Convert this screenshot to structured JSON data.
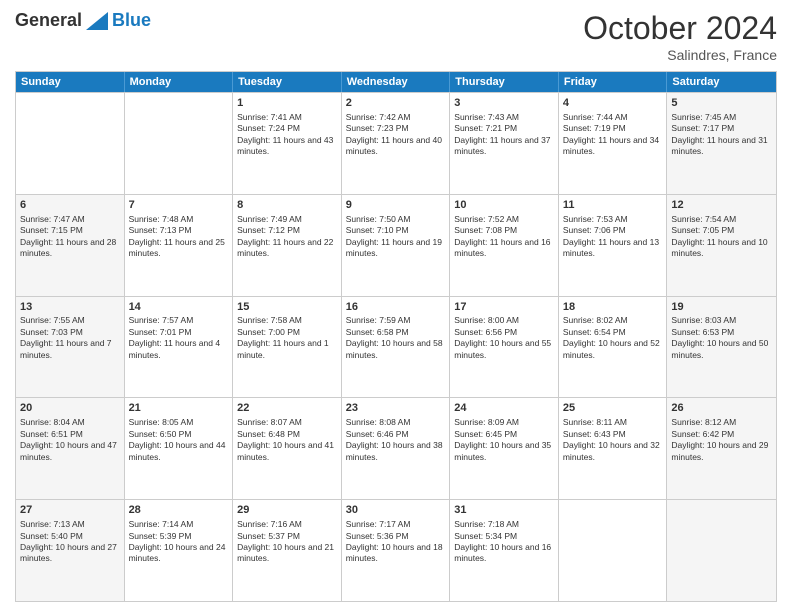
{
  "header": {
    "logo_general": "General",
    "logo_blue": "Blue",
    "month": "October 2024",
    "location": "Salindres, France"
  },
  "days_of_week": [
    "Sunday",
    "Monday",
    "Tuesday",
    "Wednesday",
    "Thursday",
    "Friday",
    "Saturday"
  ],
  "rows": [
    [
      {
        "day": "",
        "empty": true,
        "shaded": false
      },
      {
        "day": "",
        "empty": true,
        "shaded": false
      },
      {
        "day": "1",
        "sunrise": "Sunrise: 7:41 AM",
        "sunset": "Sunset: 7:24 PM",
        "daylight": "Daylight: 11 hours and 43 minutes.",
        "shaded": false
      },
      {
        "day": "2",
        "sunrise": "Sunrise: 7:42 AM",
        "sunset": "Sunset: 7:23 PM",
        "daylight": "Daylight: 11 hours and 40 minutes.",
        "shaded": false
      },
      {
        "day": "3",
        "sunrise": "Sunrise: 7:43 AM",
        "sunset": "Sunset: 7:21 PM",
        "daylight": "Daylight: 11 hours and 37 minutes.",
        "shaded": false
      },
      {
        "day": "4",
        "sunrise": "Sunrise: 7:44 AM",
        "sunset": "Sunset: 7:19 PM",
        "daylight": "Daylight: 11 hours and 34 minutes.",
        "shaded": false
      },
      {
        "day": "5",
        "sunrise": "Sunrise: 7:45 AM",
        "sunset": "Sunset: 7:17 PM",
        "daylight": "Daylight: 11 hours and 31 minutes.",
        "shaded": true
      }
    ],
    [
      {
        "day": "6",
        "sunrise": "Sunrise: 7:47 AM",
        "sunset": "Sunset: 7:15 PM",
        "daylight": "Daylight: 11 hours and 28 minutes.",
        "shaded": true
      },
      {
        "day": "7",
        "sunrise": "Sunrise: 7:48 AM",
        "sunset": "Sunset: 7:13 PM",
        "daylight": "Daylight: 11 hours and 25 minutes.",
        "shaded": false
      },
      {
        "day": "8",
        "sunrise": "Sunrise: 7:49 AM",
        "sunset": "Sunset: 7:12 PM",
        "daylight": "Daylight: 11 hours and 22 minutes.",
        "shaded": false
      },
      {
        "day": "9",
        "sunrise": "Sunrise: 7:50 AM",
        "sunset": "Sunset: 7:10 PM",
        "daylight": "Daylight: 11 hours and 19 minutes.",
        "shaded": false
      },
      {
        "day": "10",
        "sunrise": "Sunrise: 7:52 AM",
        "sunset": "Sunset: 7:08 PM",
        "daylight": "Daylight: 11 hours and 16 minutes.",
        "shaded": false
      },
      {
        "day": "11",
        "sunrise": "Sunrise: 7:53 AM",
        "sunset": "Sunset: 7:06 PM",
        "daylight": "Daylight: 11 hours and 13 minutes.",
        "shaded": false
      },
      {
        "day": "12",
        "sunrise": "Sunrise: 7:54 AM",
        "sunset": "Sunset: 7:05 PM",
        "daylight": "Daylight: 11 hours and 10 minutes.",
        "shaded": true
      }
    ],
    [
      {
        "day": "13",
        "sunrise": "Sunrise: 7:55 AM",
        "sunset": "Sunset: 7:03 PM",
        "daylight": "Daylight: 11 hours and 7 minutes.",
        "shaded": true
      },
      {
        "day": "14",
        "sunrise": "Sunrise: 7:57 AM",
        "sunset": "Sunset: 7:01 PM",
        "daylight": "Daylight: 11 hours and 4 minutes.",
        "shaded": false
      },
      {
        "day": "15",
        "sunrise": "Sunrise: 7:58 AM",
        "sunset": "Sunset: 7:00 PM",
        "daylight": "Daylight: 11 hours and 1 minute.",
        "shaded": false
      },
      {
        "day": "16",
        "sunrise": "Sunrise: 7:59 AM",
        "sunset": "Sunset: 6:58 PM",
        "daylight": "Daylight: 10 hours and 58 minutes.",
        "shaded": false
      },
      {
        "day": "17",
        "sunrise": "Sunrise: 8:00 AM",
        "sunset": "Sunset: 6:56 PM",
        "daylight": "Daylight: 10 hours and 55 minutes.",
        "shaded": false
      },
      {
        "day": "18",
        "sunrise": "Sunrise: 8:02 AM",
        "sunset": "Sunset: 6:54 PM",
        "daylight": "Daylight: 10 hours and 52 minutes.",
        "shaded": false
      },
      {
        "day": "19",
        "sunrise": "Sunrise: 8:03 AM",
        "sunset": "Sunset: 6:53 PM",
        "daylight": "Daylight: 10 hours and 50 minutes.",
        "shaded": true
      }
    ],
    [
      {
        "day": "20",
        "sunrise": "Sunrise: 8:04 AM",
        "sunset": "Sunset: 6:51 PM",
        "daylight": "Daylight: 10 hours and 47 minutes.",
        "shaded": true
      },
      {
        "day": "21",
        "sunrise": "Sunrise: 8:05 AM",
        "sunset": "Sunset: 6:50 PM",
        "daylight": "Daylight: 10 hours and 44 minutes.",
        "shaded": false
      },
      {
        "day": "22",
        "sunrise": "Sunrise: 8:07 AM",
        "sunset": "Sunset: 6:48 PM",
        "daylight": "Daylight: 10 hours and 41 minutes.",
        "shaded": false
      },
      {
        "day": "23",
        "sunrise": "Sunrise: 8:08 AM",
        "sunset": "Sunset: 6:46 PM",
        "daylight": "Daylight: 10 hours and 38 minutes.",
        "shaded": false
      },
      {
        "day": "24",
        "sunrise": "Sunrise: 8:09 AM",
        "sunset": "Sunset: 6:45 PM",
        "daylight": "Daylight: 10 hours and 35 minutes.",
        "shaded": false
      },
      {
        "day": "25",
        "sunrise": "Sunrise: 8:11 AM",
        "sunset": "Sunset: 6:43 PM",
        "daylight": "Daylight: 10 hours and 32 minutes.",
        "shaded": false
      },
      {
        "day": "26",
        "sunrise": "Sunrise: 8:12 AM",
        "sunset": "Sunset: 6:42 PM",
        "daylight": "Daylight: 10 hours and 29 minutes.",
        "shaded": true
      }
    ],
    [
      {
        "day": "27",
        "sunrise": "Sunrise: 7:13 AM",
        "sunset": "Sunset: 5:40 PM",
        "daylight": "Daylight: 10 hours and 27 minutes.",
        "shaded": true
      },
      {
        "day": "28",
        "sunrise": "Sunrise: 7:14 AM",
        "sunset": "Sunset: 5:39 PM",
        "daylight": "Daylight: 10 hours and 24 minutes.",
        "shaded": false
      },
      {
        "day": "29",
        "sunrise": "Sunrise: 7:16 AM",
        "sunset": "Sunset: 5:37 PM",
        "daylight": "Daylight: 10 hours and 21 minutes.",
        "shaded": false
      },
      {
        "day": "30",
        "sunrise": "Sunrise: 7:17 AM",
        "sunset": "Sunset: 5:36 PM",
        "daylight": "Daylight: 10 hours and 18 minutes.",
        "shaded": false
      },
      {
        "day": "31",
        "sunrise": "Sunrise: 7:18 AM",
        "sunset": "Sunset: 5:34 PM",
        "daylight": "Daylight: 10 hours and 16 minutes.",
        "shaded": false
      },
      {
        "day": "",
        "empty": true,
        "shaded": false
      },
      {
        "day": "",
        "empty": true,
        "shaded": true
      }
    ]
  ]
}
